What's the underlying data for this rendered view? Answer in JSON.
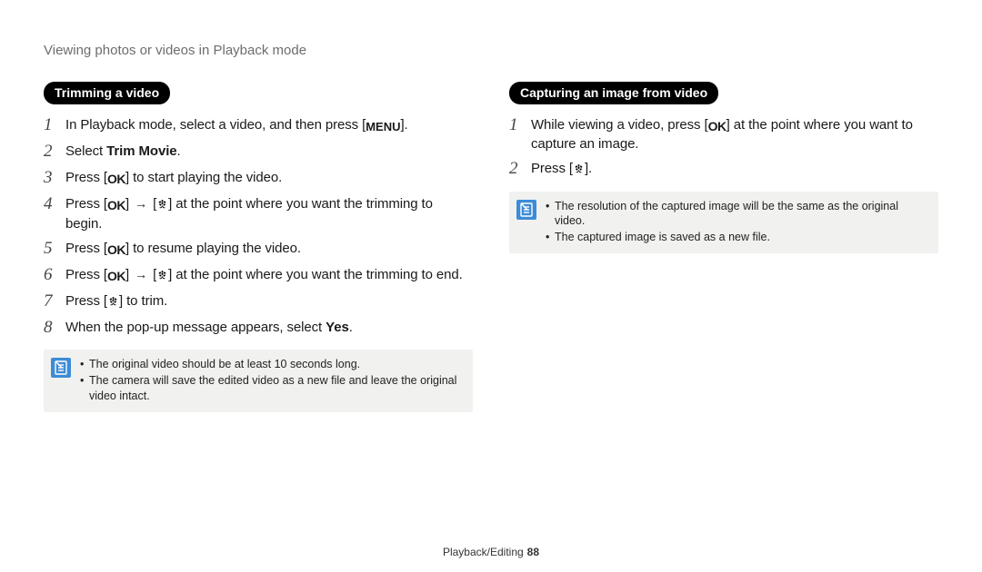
{
  "header": "Viewing photos or videos in Playback mode",
  "left": {
    "title": "Trimming a video",
    "steps": [
      {
        "n": "1",
        "pre": "In Playback mode, select a video, and then press [",
        "icon": "menu",
        "post": "]."
      },
      {
        "n": "2",
        "pre": "Select ",
        "bold": "Trim Movie",
        "post2": "."
      },
      {
        "n": "3",
        "pre": "Press [",
        "icon": "ok",
        "post": "] to start playing the video."
      },
      {
        "n": "4",
        "pre": "Press [",
        "icon": "ok",
        "mid": "] ",
        "arrow": true,
        "mid2": " [",
        "icon2": "flower",
        "post": "] at the point where you want the trimming to begin."
      },
      {
        "n": "5",
        "pre": "Press [",
        "icon": "ok",
        "post": "] to resume playing the video."
      },
      {
        "n": "6",
        "pre": "Press [",
        "icon": "ok",
        "mid": "] ",
        "arrow": true,
        "mid2": " [",
        "icon2": "flower",
        "post": "] at the point where you want the trimming to end."
      },
      {
        "n": "7",
        "pre": "Press [",
        "icon": "flower",
        "post": "] to trim."
      },
      {
        "n": "8",
        "pre": "When the pop-up message appears, select ",
        "bold": "Yes",
        "post2": "."
      }
    ],
    "notes": [
      "The original video should be at least 10 seconds long.",
      "The camera will save the edited video as a new file and leave the original video intact."
    ]
  },
  "right": {
    "title": "Capturing an image from video",
    "steps": [
      {
        "n": "1",
        "pre": "While viewing a video, press [",
        "icon": "ok",
        "post": "] at the point where you want to capture an image."
      },
      {
        "n": "2",
        "pre": "Press [",
        "icon": "flower",
        "post": "]."
      }
    ],
    "notes": [
      "The resolution of the captured image will be the same as the original video.",
      "The captured image is saved as a new file."
    ]
  },
  "footer": {
    "section": "Playback/Editing",
    "page": "88"
  }
}
